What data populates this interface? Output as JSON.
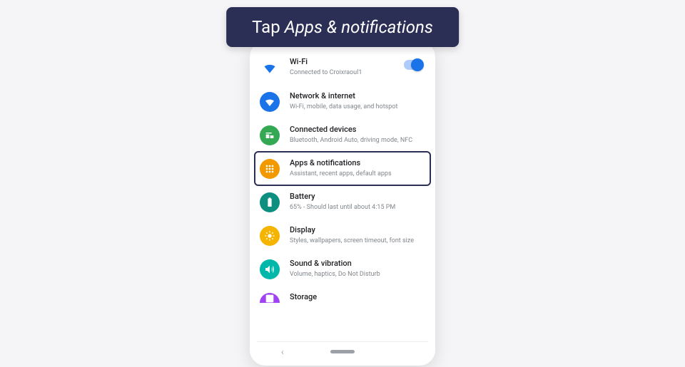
{
  "instruction": {
    "prefix": "Tap ",
    "emph": "Apps & notifications"
  },
  "rows": {
    "wifi": {
      "title": "Wi-Fi",
      "sub": "Connected to Croixraoul1"
    },
    "network": {
      "title": "Network & internet",
      "sub": "Wi-Fi, mobile, data usage, and hotspot"
    },
    "connected": {
      "title": "Connected devices",
      "sub": "Bluetooth, Android Auto, driving mode, NFC"
    },
    "apps": {
      "title": "Apps & notifications",
      "sub": "Assistant, recent apps, default apps"
    },
    "battery": {
      "title": "Battery",
      "sub": "65% - Should last until about 4:15 PM"
    },
    "display": {
      "title": "Display",
      "sub": "Styles, wallpapers, screen timeout, font size"
    },
    "sound": {
      "title": "Sound & vibration",
      "sub": "Volume, haptics, Do Not Disturb"
    },
    "storage": {
      "title": "Storage",
      "sub": ""
    }
  }
}
